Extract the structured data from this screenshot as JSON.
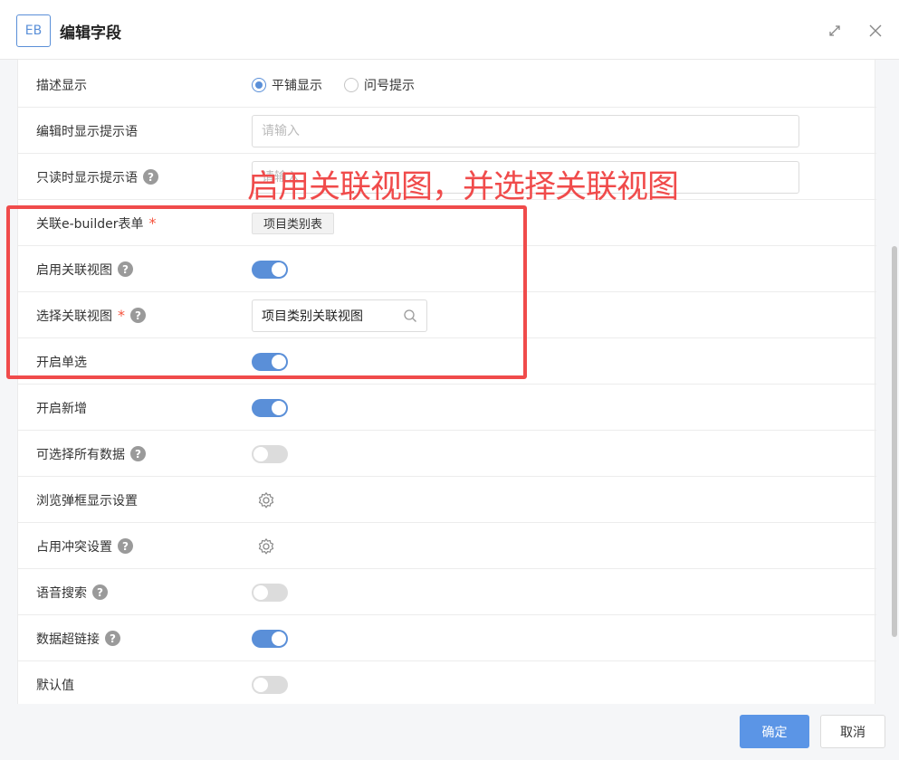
{
  "header": {
    "logo_text": "EB",
    "title": "编辑字段"
  },
  "rows": {
    "desc_display": {
      "label": "描述显示",
      "options": [
        "平铺显示",
        "问号提示"
      ],
      "selected": "平铺显示"
    },
    "edit_hint": {
      "label": "编辑时显示提示语",
      "placeholder": "请输入",
      "value": ""
    },
    "readonly_hint": {
      "label": "只读时显示提示语",
      "placeholder": "请输入",
      "value": ""
    },
    "linked_form": {
      "label": "关联e-builder表单",
      "required_mark": "*",
      "value": "项目类别表"
    },
    "enable_linked_view": {
      "label": "启用关联视图",
      "on": true
    },
    "select_linked_view": {
      "label": "选择关联视图",
      "required_mark": "*",
      "value": "项目类别关联视图"
    },
    "single_select": {
      "label": "开启单选",
      "on": true
    },
    "enable_add": {
      "label": "开启新增",
      "on": true
    },
    "select_all_data": {
      "label": "可选择所有数据",
      "on": false
    },
    "browse_popup_settings": {
      "label": "浏览弹框显示设置"
    },
    "conflict_settings": {
      "label": "占用冲突设置"
    },
    "voice_search": {
      "label": "语音搜索",
      "on": false
    },
    "data_hyperlink": {
      "label": "数据超链接",
      "on": true
    },
    "default_value": {
      "label": "默认值",
      "on": false
    }
  },
  "help_glyph": "?",
  "annotation": {
    "text": "启用关联视图，并选择关联视图",
    "color": "#f04b4b"
  },
  "footer": {
    "ok_label": "确定",
    "cancel_label": "取消"
  },
  "colors": {
    "accent": "#5a8fd8",
    "required": "#f5533d"
  }
}
